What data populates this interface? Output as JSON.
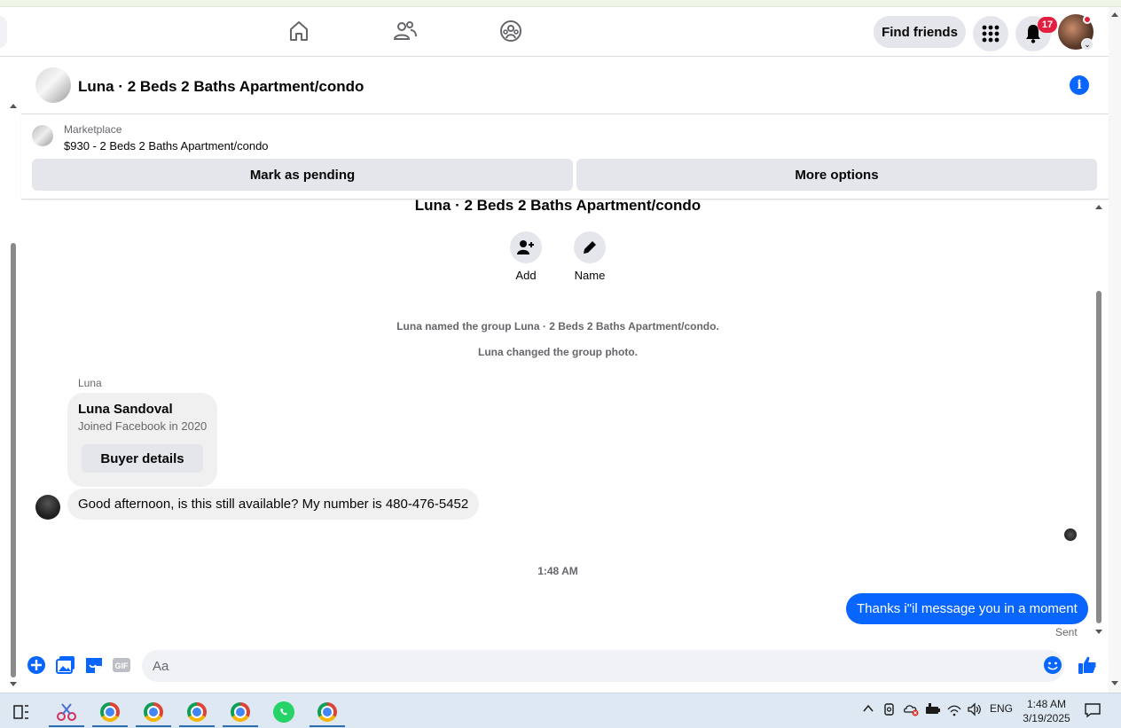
{
  "navbar": {
    "find_friends_label": "Find friends",
    "notification_count": "17"
  },
  "chat": {
    "header_title": "Luna · 2 Beds 2 Baths Apartment/condo",
    "marketplace": {
      "source_label": "Marketplace",
      "listing_text": "$930 - 2 Beds 2 Baths Apartment/condo",
      "mark_pending_label": "Mark as pending",
      "more_options_label": "More options"
    },
    "group_title": "Luna · 2 Beds 2 Baths Apartment/condo",
    "actions": [
      {
        "label": "Add",
        "icon": "add-person-icon"
      },
      {
        "label": "Name",
        "icon": "pencil-icon"
      }
    ],
    "system_messages": [
      "Luna named the group Luna · 2 Beds 2 Baths Apartment/condo.",
      "Luna changed the group photo."
    ],
    "sender_label": "Luna",
    "profile_card": {
      "name": "Luna Sandoval",
      "subtitle": "Joined Facebook in 2020",
      "button_label": "Buyer details"
    },
    "incoming_message": "Good afternoon, is this still available? My number is 480-476-5452",
    "timestamp": "1:48 AM",
    "outgoing_message": "Thanks i\"il message you in a moment",
    "outgoing_status": "Sent",
    "composer_placeholder": "Aa"
  },
  "taskbar": {
    "language": "ENG",
    "time": "1:48 AM",
    "date": "3/19/2025"
  },
  "colors": {
    "accent": "#0866ff",
    "badge": "#e41e3f",
    "bubble_incoming": "#f0f0f0"
  }
}
